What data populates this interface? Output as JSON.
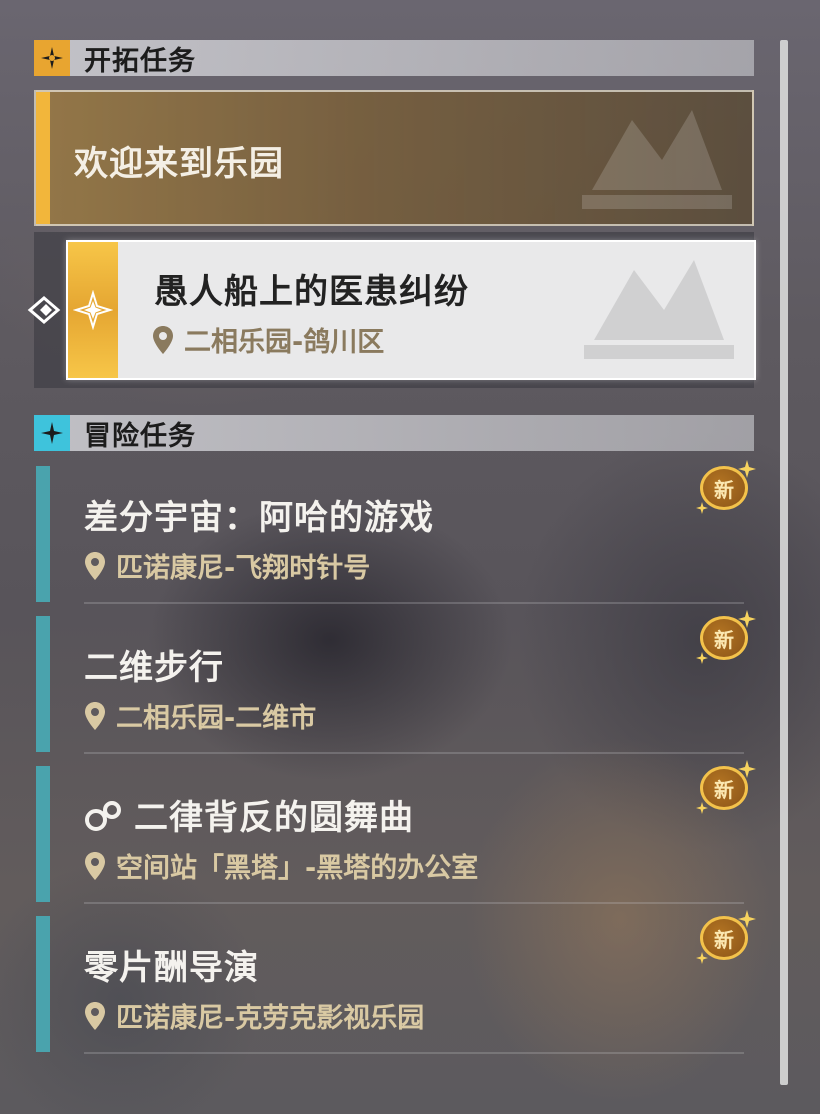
{
  "trailblaze": {
    "header": "开拓任务",
    "main_quest": "欢迎来到乐园",
    "sub_quest": {
      "title": "愚人船上的医患纠纷",
      "location": "二相乐园-鸽川区"
    }
  },
  "adventure": {
    "header": "冒险任务",
    "items": [
      {
        "title": "差分宇宙：阿哈的游戏",
        "location": "匹诺康尼-飞翔时针号",
        "badge": "新"
      },
      {
        "title": "二维步行",
        "location": "二相乐园-二维市",
        "badge": "新"
      },
      {
        "title": "二律背反的圆舞曲",
        "location": "空间站「黑塔」-黑塔的办公室",
        "badge": "新",
        "icon": "link-ring-icon"
      },
      {
        "title": "零片酬导演",
        "location": "匹诺康尼-克劳克影视乐园",
        "badge": "新"
      }
    ]
  },
  "colors": {
    "gold": "#f2b63b",
    "cyan": "#3ec3dc",
    "teal_bar": "#4aa3ad",
    "location_text": "#d9c9a3"
  }
}
